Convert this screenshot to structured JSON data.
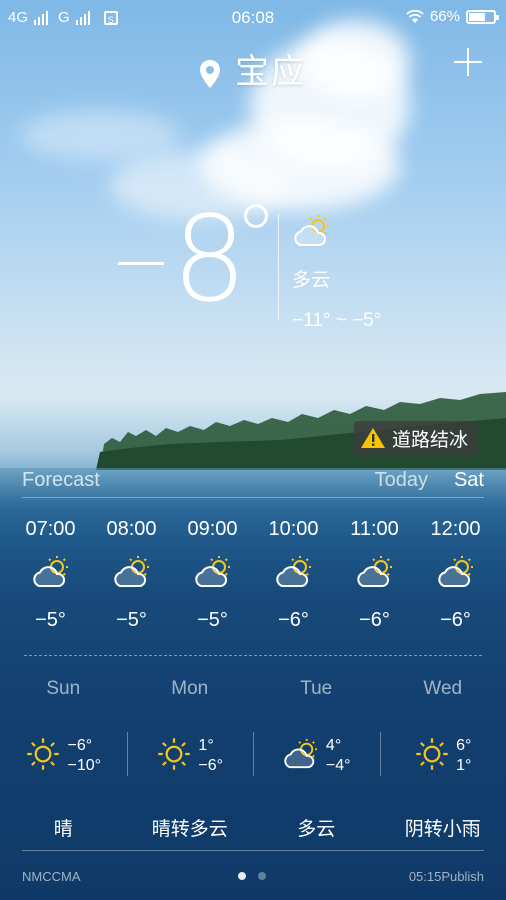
{
  "status_bar": {
    "network1": "4G",
    "network2": "G",
    "sim_label": "S",
    "time": "06:08",
    "battery": "66%",
    "battery_level": 0.66
  },
  "header": {
    "city": "宝应"
  },
  "current": {
    "temp_value": "8",
    "condition": "多云",
    "range": "−11° ~ −5°"
  },
  "alert": {
    "text": "道路结冰"
  },
  "forecast_header": {
    "title": "Forecast",
    "today": "Today",
    "day": "Sat"
  },
  "hourly": [
    {
      "time": "07:00",
      "temp": "−5°",
      "icon": "partly-cloudy-icon"
    },
    {
      "time": "08:00",
      "temp": "−5°",
      "icon": "partly-cloudy-icon"
    },
    {
      "time": "09:00",
      "temp": "−5°",
      "icon": "partly-cloudy-icon"
    },
    {
      "time": "10:00",
      "temp": "−6°",
      "icon": "partly-cloudy-icon"
    },
    {
      "time": "11:00",
      "temp": "−6°",
      "icon": "partly-cloudy-icon"
    },
    {
      "time": "12:00",
      "temp": "−6°",
      "icon": "partly-cloudy-icon"
    }
  ],
  "daily": [
    {
      "name": "Sun",
      "high": "−6°",
      "low": "−10°",
      "desc": "晴",
      "icon": "sun-icon"
    },
    {
      "name": "Mon",
      "high": "1°",
      "low": "−6°",
      "desc": "晴转多云",
      "icon": "sun-icon"
    },
    {
      "name": "Tue",
      "high": "4°",
      "low": "−4°",
      "desc": "多云",
      "icon": "partly-cloudy-icon"
    },
    {
      "name": "Wed",
      "high": "6°",
      "low": "1°",
      "desc": "阴转小雨",
      "icon": "sun-icon"
    }
  ],
  "footer": {
    "source": "NMCCMA",
    "publish": "05:15Publish"
  },
  "colors": {
    "sun": "#f5c518",
    "alert_icon": "#f7c600"
  }
}
